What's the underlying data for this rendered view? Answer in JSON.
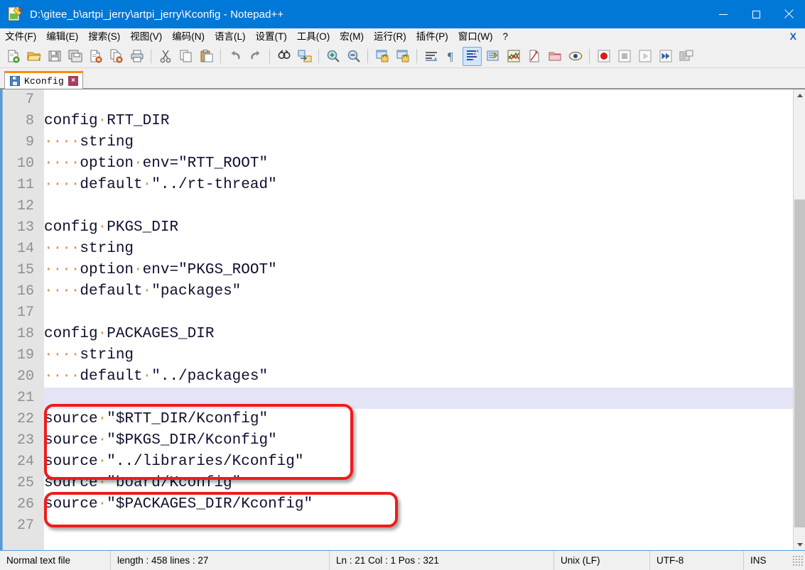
{
  "window": {
    "title": "D:\\gitee_b\\artpi_jerry\\artpi_jerry\\Kconfig - Notepad++",
    "app_icon": "notepad-plus-plus-icon",
    "accent_color": "#0078d7",
    "controls": {
      "minimize": "minimize-icon",
      "maximize": "maximize-icon",
      "close": "close-icon"
    }
  },
  "menubar": {
    "items": [
      {
        "label": "文件(F)",
        "name": "menu-file"
      },
      {
        "label": "编辑(E)",
        "name": "menu-edit"
      },
      {
        "label": "搜索(S)",
        "name": "menu-search"
      },
      {
        "label": "视图(V)",
        "name": "menu-view"
      },
      {
        "label": "编码(N)",
        "name": "menu-encoding"
      },
      {
        "label": "语言(L)",
        "name": "menu-language"
      },
      {
        "label": "设置(T)",
        "name": "menu-settings"
      },
      {
        "label": "工具(O)",
        "name": "menu-tools"
      },
      {
        "label": "宏(M)",
        "name": "menu-macro"
      },
      {
        "label": "运行(R)",
        "name": "menu-run"
      },
      {
        "label": "插件(P)",
        "name": "menu-plugins"
      },
      {
        "label": "窗口(W)",
        "name": "menu-window"
      },
      {
        "label": "?",
        "name": "menu-help"
      }
    ],
    "close_document": "X"
  },
  "toolbar": {
    "icons": [
      "new-file-icon",
      "open-file-icon",
      "save-icon",
      "save-all-icon",
      "close-file-icon",
      "close-all-files-icon",
      "print-icon",
      "cut-icon",
      "copy-icon",
      "paste-icon",
      "undo-icon",
      "redo-icon",
      "find-icon",
      "replace-icon",
      "zoom-in-icon",
      "zoom-out-icon",
      "sync-vertical-scroll-icon",
      "sync-horizontal-scroll-icon",
      "word-wrap-icon",
      "show-formatting-icon",
      "show-all-characters-icon",
      "indent-guide-icon",
      "user-defined-language-icon",
      "document-map-icon",
      "function-list-icon",
      "folder-as-workspace-icon",
      "monitoring-icon",
      "record-macro-icon",
      "stop-recording-icon",
      "play-macro-icon",
      "run-macro-multiple-icon",
      "save-macro-icon"
    ],
    "active_icon": "show-all-characters-icon"
  },
  "tabs": [
    {
      "label": "Kconfig",
      "icon": "saved-file-icon",
      "close": "×",
      "active": true
    }
  ],
  "editor": {
    "first_visible_line": 7,
    "current_line": 21,
    "current_line_color": "#e4e4f7",
    "gutter_color": "#e4e4e4",
    "whitespace_dot_color": "#d9934a",
    "lines": [
      {
        "num": 7,
        "text": ""
      },
      {
        "num": 8,
        "text": "config·RTT_DIR"
      },
      {
        "num": 9,
        "text": "····string"
      },
      {
        "num": 10,
        "text": "····option·env=\"RTT_ROOT\""
      },
      {
        "num": 11,
        "text": "····default·\"../rt-thread\""
      },
      {
        "num": 12,
        "text": ""
      },
      {
        "num": 13,
        "text": "config·PKGS_DIR"
      },
      {
        "num": 14,
        "text": "····string"
      },
      {
        "num": 15,
        "text": "····option·env=\"PKGS_ROOT\""
      },
      {
        "num": 16,
        "text": "····default·\"packages\""
      },
      {
        "num": 17,
        "text": ""
      },
      {
        "num": 18,
        "text": "config·PACKAGES_DIR"
      },
      {
        "num": 19,
        "text": "····string"
      },
      {
        "num": 20,
        "text": "····default·\"../packages\""
      },
      {
        "num": 21,
        "text": ""
      },
      {
        "num": 22,
        "text": "source·\"$RTT_DIR/Kconfig\""
      },
      {
        "num": 23,
        "text": "source·\"$PKGS_DIR/Kconfig\""
      },
      {
        "num": 24,
        "text": "source·\"../libraries/Kconfig\""
      },
      {
        "num": 25,
        "text": "source·\"board/Kconfig\""
      },
      {
        "num": 26,
        "text": "source·\"$PACKAGES_DIR/Kconfig\""
      },
      {
        "num": 27,
        "text": ""
      }
    ]
  },
  "annotations": {
    "color": "#ee1c1c",
    "boxes": [
      {
        "name": "packages-dir-config-highlight",
        "covers_lines": "18-20"
      },
      {
        "name": "packages-dir-source-highlight",
        "covers_lines": "26"
      }
    ]
  },
  "scrollbar": {
    "up": "scroll-up-arrow-icon",
    "down": "scroll-down-arrow-icon"
  },
  "statusbar": {
    "file_type": "Normal text file",
    "length_lines": "length : 458    lines : 27",
    "position": "Ln : 21    Col : 1    Pos : 321",
    "eol": "Unix (LF)",
    "encoding": "UTF-8",
    "insert_mode": "INS"
  }
}
